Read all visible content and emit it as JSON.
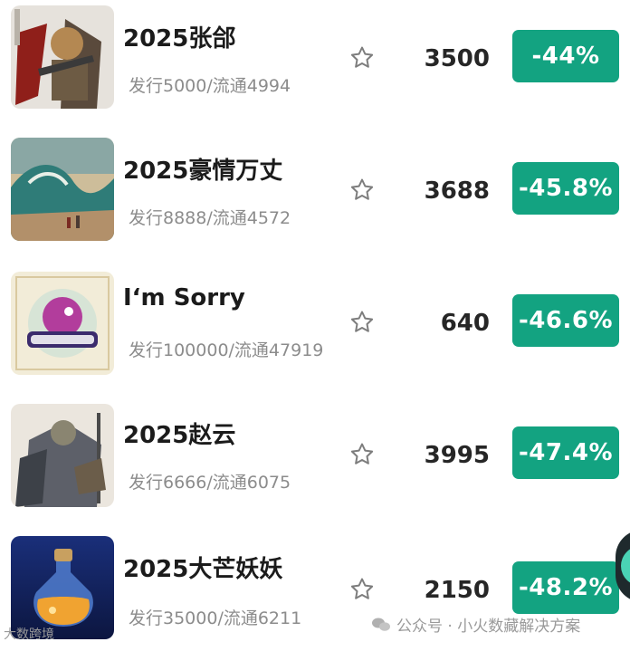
{
  "items": [
    {
      "title": "2025张郃",
      "sub": "发行5000/流通4994",
      "price": "3500",
      "change": "-44%",
      "thumb": "warrior-art"
    },
    {
      "title": "2025豪情万丈",
      "sub": "发行8888/流通4572",
      "price": "3688",
      "change": "-45.8%",
      "thumb": "wave-landscape-art"
    },
    {
      "title": "I‘m Sorry",
      "sub": "发行100000/流通47919",
      "price": "640",
      "change": "-46.6%",
      "thumb": "dinosaur-badge-art"
    },
    {
      "title": "2025赵云",
      "sub": "发行6666/流通6075",
      "price": "3995",
      "change": "-47.4%",
      "thumb": "general-art"
    },
    {
      "title": "2025大芒妖妖",
      "sub": "发行35000/流通6211",
      "price": "2150",
      "change": "-48.2%",
      "thumb": "potion-bottle-art"
    }
  ],
  "watermark": {
    "left": "大数跨境",
    "right": "公众号 · 小火数藏解决方案"
  },
  "colors": {
    "change_bg": "#13a381",
    "title": "#1b1b1b",
    "sub": "#8c8c8c"
  },
  "icons": {
    "favorite": "star-outline-icon",
    "wechat": "wechat-icon"
  }
}
